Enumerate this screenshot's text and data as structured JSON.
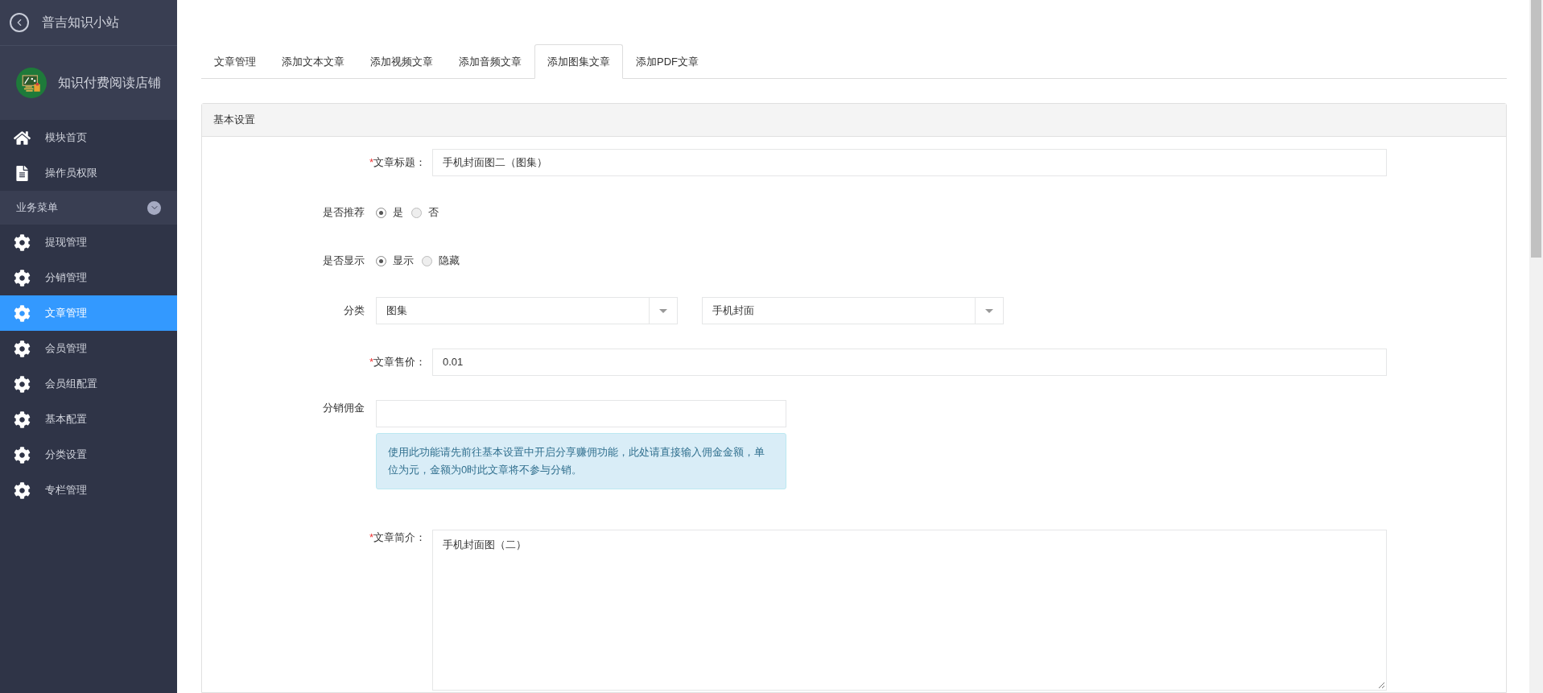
{
  "sidebar": {
    "app_title": "普吉知识小站",
    "shop_name": "知识付费阅读店铺",
    "top_items": [
      {
        "label": "模块首页",
        "kind": "home"
      },
      {
        "label": "操作员权限",
        "kind": "document"
      }
    ],
    "section": {
      "label": "业务菜单",
      "expanded": true
    },
    "items": [
      {
        "label": "提现管理",
        "selected": false
      },
      {
        "label": "分销管理",
        "selected": false
      },
      {
        "label": "文章管理",
        "selected": true
      },
      {
        "label": "会员管理",
        "selected": false
      },
      {
        "label": "会员组配置",
        "selected": false
      },
      {
        "label": "基本配置",
        "selected": false
      },
      {
        "label": "分类设置",
        "selected": false
      },
      {
        "label": "专栏管理",
        "selected": false
      }
    ]
  },
  "tabs": [
    {
      "label": "文章管理",
      "selected": false
    },
    {
      "label": "添加文本文章",
      "selected": false
    },
    {
      "label": "添加视频文章",
      "selected": false
    },
    {
      "label": "添加音频文章",
      "selected": false
    },
    {
      "label": "添加图集文章",
      "selected": true
    },
    {
      "label": "添加PDF文章",
      "selected": false
    }
  ],
  "panel": {
    "title": "基本设置",
    "fields": [
      {
        "kind": "text",
        "label": "文章标题：",
        "required_mark": "*",
        "value": "手机封面图二（图集）"
      },
      {
        "kind": "radio",
        "label": "是否推荐",
        "options": [
          {
            "label": "是",
            "selected": true
          },
          {
            "label": "否",
            "selected": false
          }
        ]
      },
      {
        "kind": "radio",
        "label": "是否显示",
        "options": [
          {
            "label": "显示",
            "selected": true
          },
          {
            "label": "隐藏",
            "selected": false
          }
        ]
      },
      {
        "kind": "select",
        "label": "分类",
        "selects": [
          {
            "value": "图集"
          },
          {
            "value": "手机封面"
          }
        ]
      },
      {
        "kind": "text",
        "label": "文章售价：",
        "required_mark": "*",
        "value": "0.01"
      },
      {
        "kind": "commission",
        "label": "分销佣金",
        "help": "使用此功能请先前往基本设置中开启分享赚佣功能，此处请直接输入佣金金额，单位为元，金额为0时此文章将不参与分销。"
      },
      {
        "kind": "textarea",
        "label": "文章简介：",
        "required_mark": "*",
        "value": "手机封面图（二）"
      }
    ]
  }
}
